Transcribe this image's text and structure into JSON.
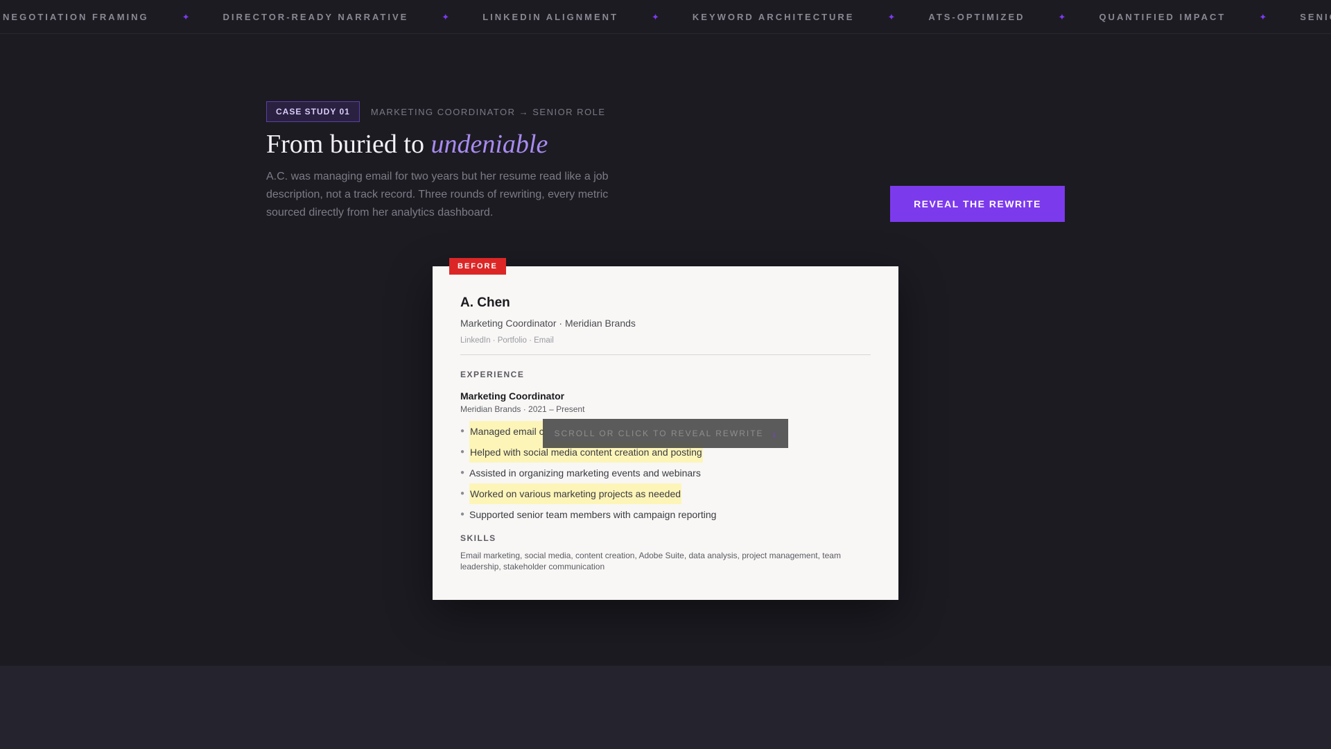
{
  "ticker": {
    "items": [
      "Y NEGOTIATION FRAMING",
      "DIRECTOR-READY NARRATIVE",
      "LINKEDIN ALIGNMENT",
      "KEYWORD ARCHITECTURE",
      "ATS-OPTIMIZED",
      "QUANTIFIED IMPACT",
      "SENIOR-LE"
    ],
    "separator": "✦"
  },
  "case": {
    "badge": "CASE STUDY 01",
    "subtitle": "MARKETING COORDINATOR → SENIOR ROLE",
    "headline_prefix": "From buried to ",
    "headline_accent": "undeniable",
    "description": "A.C. was managing email for two years but her resume read like a job description, not a track record. Three rounds of rewriting, every metric sourced directly from her analytics dashboard.",
    "reveal_button": "REVEAL THE REWRITE"
  },
  "resume": {
    "tag": "BEFORE",
    "name": "A. Chen",
    "title": "Marketing Coordinator · Meridian Brands",
    "links": "LinkedIn · Portfolio · Email",
    "experience_heading": "EXPERIENCE",
    "job_title": "Marketing Coordinator",
    "job_meta": "Meridian Brands · 2021 – Present",
    "bullets": [
      {
        "text": "Managed email c",
        "highlight": true
      },
      {
        "text": "Helped with social media content creation and posting",
        "highlight": true
      },
      {
        "text": "Assisted in organizing marketing events and webinars",
        "highlight": false
      },
      {
        "text": "Worked on various marketing projects as needed",
        "highlight": true
      },
      {
        "text": "Supported senior team members with campaign reporting",
        "highlight": false
      }
    ],
    "skills_heading": "SKILLS",
    "skills": "Email marketing, social media, content creation, Adobe Suite, data analysis, project management, team leadership, stakeholder communication"
  },
  "overlay": {
    "text": "SCROLL OR CLICK TO REVEAL REWRITE",
    "arrow": "↓"
  },
  "colors": {
    "accent": "#7c3aed",
    "before_red": "#dc2626",
    "highlight": "#fdf5b8"
  }
}
